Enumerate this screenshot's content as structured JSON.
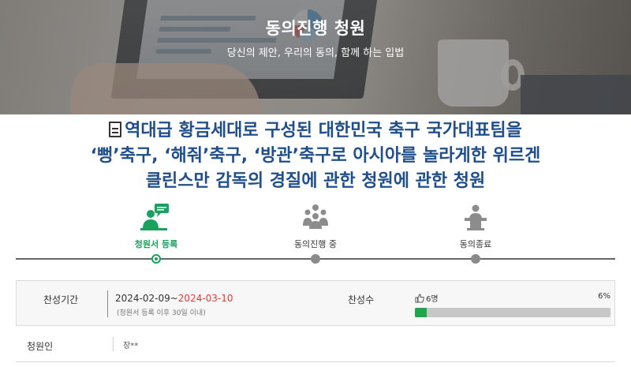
{
  "hero": {
    "title": "동의진행 청원",
    "subtitle": "당신의 제안, 우리의 동의, 함께 하는 입법"
  },
  "petition": {
    "title_lines": [
      "역대급 황금세대로 구성된 대한민국 축구 국가대표팀을",
      "‘뻥’축구, ‘해줘’축구, ‘방관’축구로 아시아를 놀라게한 위르겐",
      "클린스만 감독의 경질에 관한 청원에 관한 청원"
    ],
    "icon": "document-icon"
  },
  "steps": [
    {
      "label": "청원서 등록",
      "icon": "chat-person-icon",
      "active": true
    },
    {
      "label": "동의진행 중",
      "icon": "crowd-icon",
      "active": false
    },
    {
      "label": "동의종료",
      "icon": "podium-icon",
      "active": false
    }
  ],
  "info": {
    "period_label": "찬성기간",
    "period_start": "2024-02-09~",
    "period_end": "2024-03-10",
    "period_note": "(청원서 등록 이후 30일 이내)",
    "support_label": "찬성수",
    "support_count": "6명",
    "support_percent": "6%",
    "support_fraction": 0.06
  },
  "petitioner": {
    "label": "청원인",
    "value": "장**"
  },
  "colors": {
    "accent_green": "#1aa05f",
    "title_blue": "#1f4e8c",
    "end_date_red": "#e53935",
    "progress_fill": "#22a34c"
  }
}
